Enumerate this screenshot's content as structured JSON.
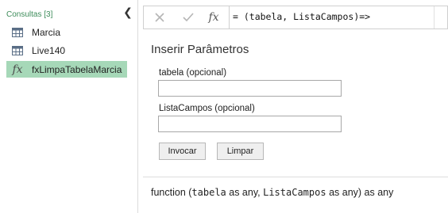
{
  "sidebar": {
    "header": "Consultas [3]",
    "items": [
      {
        "label": "Marcia",
        "icon": "table-icon"
      },
      {
        "label": "Live140",
        "icon": "table-icon"
      },
      {
        "label": "fxLimpaTabelaMarcia",
        "icon": "function-icon"
      }
    ],
    "collapse_icon": "chevron-left-icon"
  },
  "formula_bar": {
    "fx_label": "fx",
    "formula": "= (tabela, ListaCampos)=>"
  },
  "params": {
    "title": "Inserir Parâmetros",
    "fields": [
      {
        "label": "tabela (opcional)",
        "value": ""
      },
      {
        "label": "ListaCampos (opcional)",
        "value": ""
      }
    ],
    "invoke_label": "Invocar",
    "clear_label": "Limpar"
  },
  "signature": {
    "prefix": "function (",
    "param1": "tabela",
    "mid1": " as any, ",
    "param2": "ListaCampos",
    "suffix": " as any) as any"
  },
  "colors": {
    "selected_bg": "#a6d8b8",
    "header_text": "#3d8c5a"
  }
}
